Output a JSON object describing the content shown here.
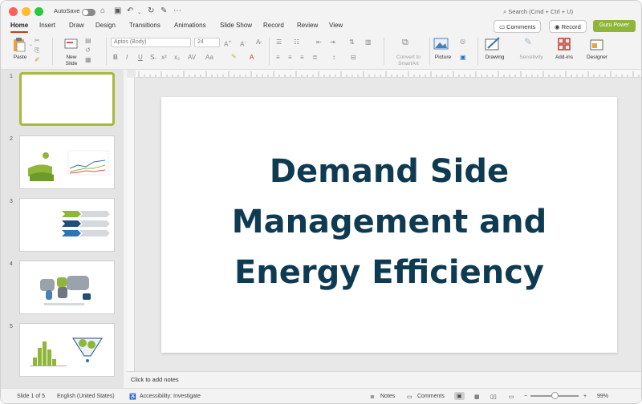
{
  "titlebar": {
    "autosave_label": "AutoSave",
    "search_placeholder": "Search (Cmd + Ctrl + U)"
  },
  "tabs": [
    "Home",
    "Insert",
    "Draw",
    "Design",
    "Transitions",
    "Animations",
    "Slide Show",
    "Record",
    "Review",
    "View"
  ],
  "active_tab": "Home",
  "top_buttons": {
    "comments": "Comments",
    "record": "Record",
    "guru": "Guru Power"
  },
  "ribbon": {
    "paste": "Paste",
    "new_slide": "New\nSlide",
    "font_name": "Aptos (Body)",
    "font_size": "24",
    "convert_smartart": "Convert to\nSmartArt",
    "picture": "Picture",
    "drawing": "Drawing",
    "sensitivity": "Sensitivity",
    "addins": "Add-ins",
    "designer": "Designer"
  },
  "thumbnails": [
    {
      "number": "1",
      "selected": true
    },
    {
      "number": "2",
      "selected": false
    },
    {
      "number": "3",
      "selected": false
    },
    {
      "number": "4",
      "selected": false
    },
    {
      "number": "5",
      "selected": false
    }
  ],
  "slide": {
    "line1": "Demand Side",
    "line2": "Management and",
    "line3": "Energy Efficiency"
  },
  "notes_placeholder": "Click to add notes",
  "status": {
    "slide_info": "Slide 1 of 5",
    "language": "English (United States)",
    "accessibility": "Accessibility: Investigate",
    "notes": "Notes",
    "comments": "Comments",
    "zoom": "99%"
  },
  "colors": {
    "accent_tab": "#c43e1c",
    "title_text": "#0e3a52",
    "thumb_accent": "#a8b83a",
    "guru_button": "#8fb63a"
  }
}
